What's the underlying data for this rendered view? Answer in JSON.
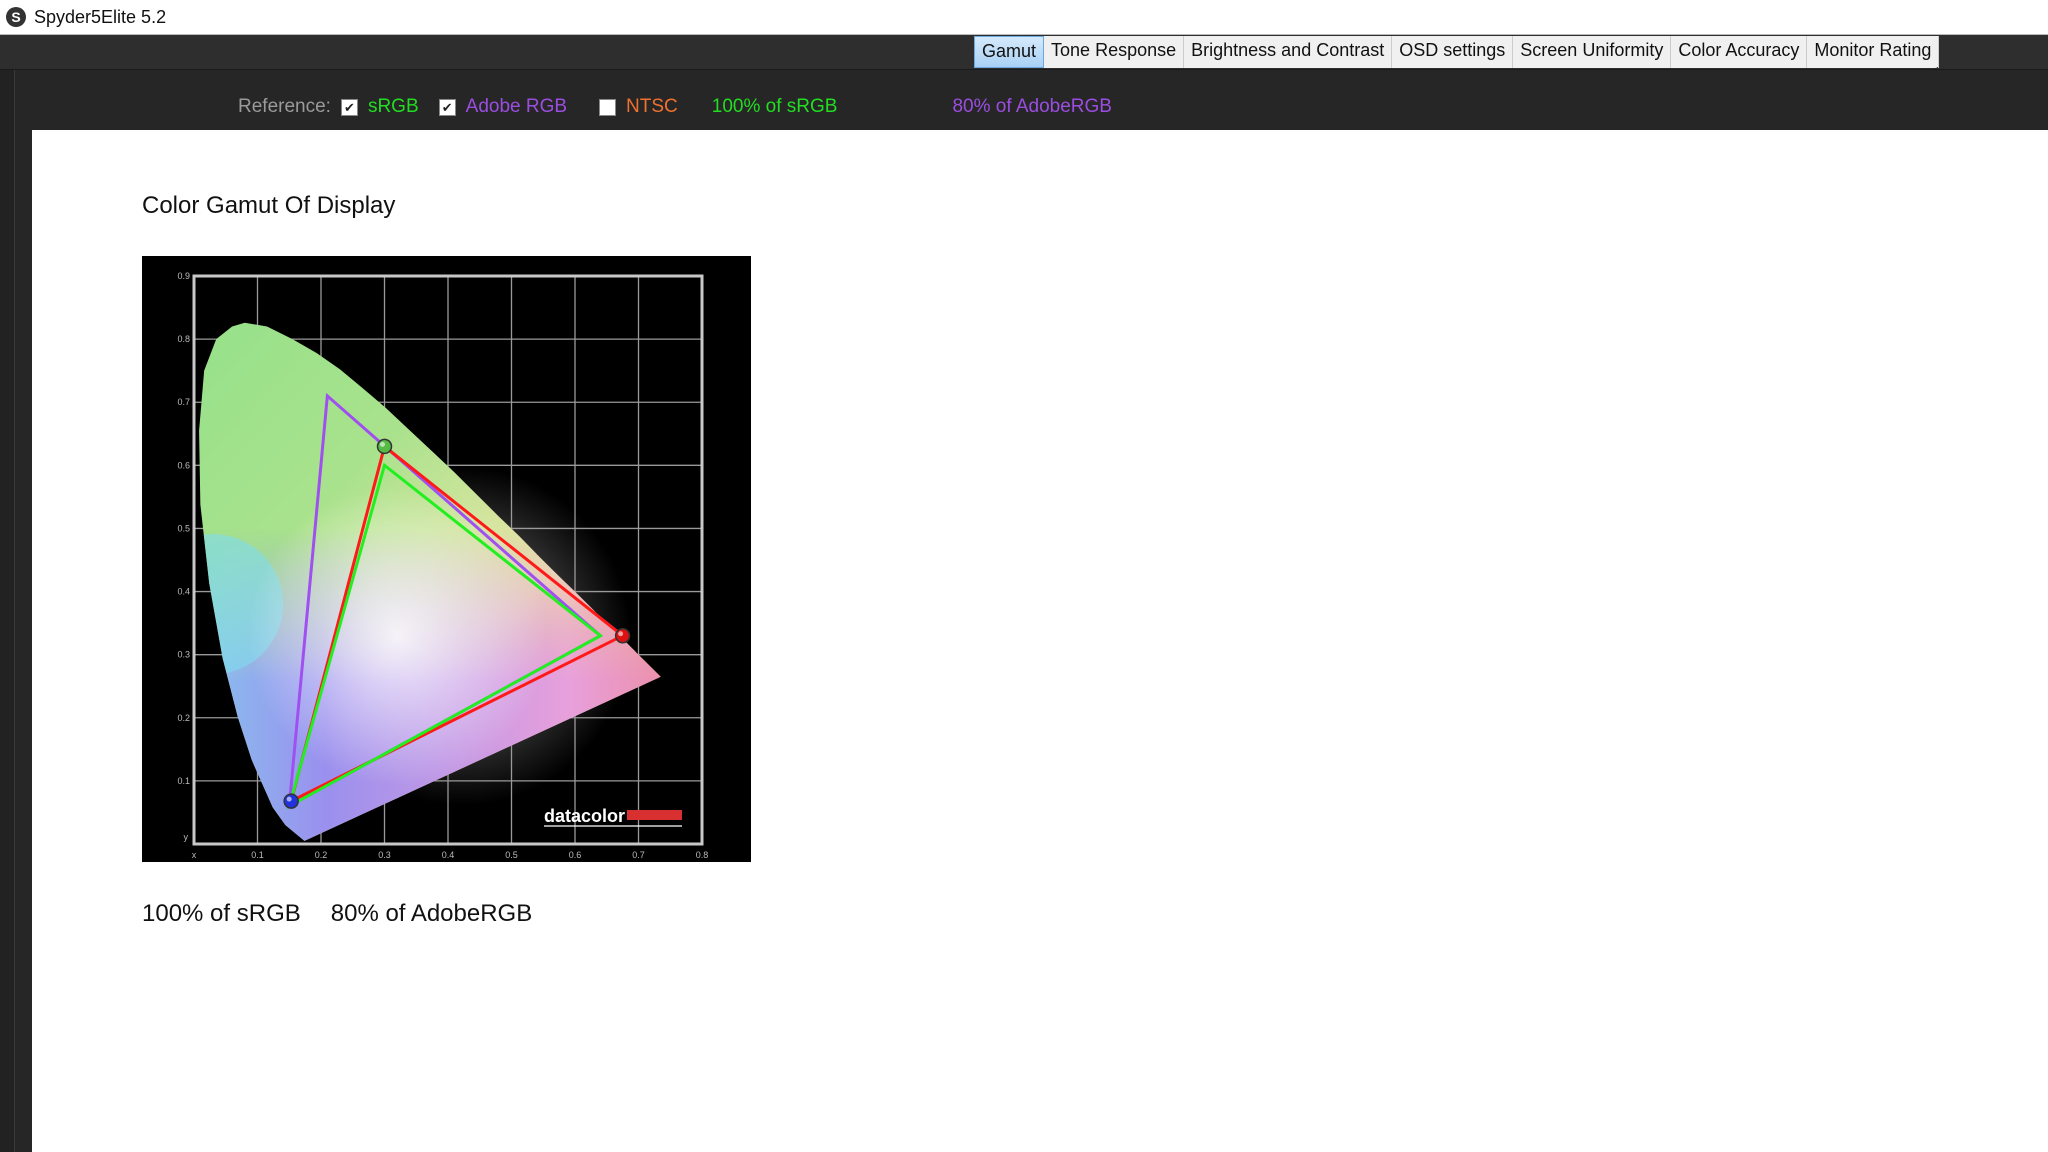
{
  "app": {
    "title": "Spyder5Elite 5.2",
    "icon": "spyder-logo-icon"
  },
  "tabs": [
    {
      "label": "Gamut",
      "active": true
    },
    {
      "label": "Tone Response",
      "active": false
    },
    {
      "label": "Brightness and Contrast",
      "active": false
    },
    {
      "label": "OSD settings",
      "active": false
    },
    {
      "label": "Screen Uniformity",
      "active": false
    },
    {
      "label": "Color Accuracy",
      "active": false
    },
    {
      "label": "Monitor Rating",
      "active": false
    }
  ],
  "reference": {
    "label": "Reference:",
    "options": [
      {
        "label": "sRGB",
        "checked": true,
        "color": "#22dd22"
      },
      {
        "label": "Adobe RGB",
        "checked": true,
        "color": "#9b4de0"
      },
      {
        "label": "NTSC",
        "checked": false,
        "color": "#f07030"
      }
    ],
    "srgb_result": "100% of sRGB",
    "srgb_result_color": "#22dd22",
    "adobe_result": "80% of AdobeRGB",
    "adobe_result_color": "#9b4de0"
  },
  "main": {
    "title": "Color Gamut Of Display",
    "summary_srgb": "100% of sRGB",
    "summary_adobe": "80% of AdobeRGB"
  },
  "chart_data": {
    "type": "scatter",
    "title": "",
    "xlabel": "x",
    "ylabel": "y",
    "xlim": [
      0,
      0.8
    ],
    "ylim": [
      0,
      0.9
    ],
    "grid": true,
    "x_ticks": [
      "0.1",
      "0.2",
      "0.3",
      "0.4",
      "0.5",
      "0.6",
      "0.7",
      "0.8"
    ],
    "y_ticks": [
      "0.1",
      "0.2",
      "0.3",
      "0.4",
      "0.5",
      "0.6",
      "0.7",
      "0.8",
      "0.9"
    ],
    "watermark": "datacolor",
    "series": [
      {
        "id": "adobe",
        "color": "#a050f0",
        "points": [
          [
            0.64,
            0.33
          ],
          [
            0.21,
            0.71
          ],
          [
            0.15,
            0.06
          ]
        ]
      },
      {
        "id": "display",
        "color": "#ff1a1a",
        "points": [
          [
            0.675,
            0.33
          ],
          [
            0.3,
            0.63
          ],
          [
            0.153,
            0.068
          ]
        ]
      },
      {
        "id": "srgb",
        "color": "#22ee22",
        "points": [
          [
            0.64,
            0.33
          ],
          [
            0.3,
            0.6
          ],
          [
            0.15,
            0.06
          ]
        ]
      }
    ],
    "primaries": [
      {
        "name": "red",
        "x": 0.675,
        "y": 0.33,
        "color": "#dd1111"
      },
      {
        "name": "green",
        "x": 0.3,
        "y": 0.63,
        "color": "#55bb44"
      },
      {
        "name": "blue",
        "x": 0.153,
        "y": 0.068,
        "color": "#2233dd"
      }
    ]
  }
}
